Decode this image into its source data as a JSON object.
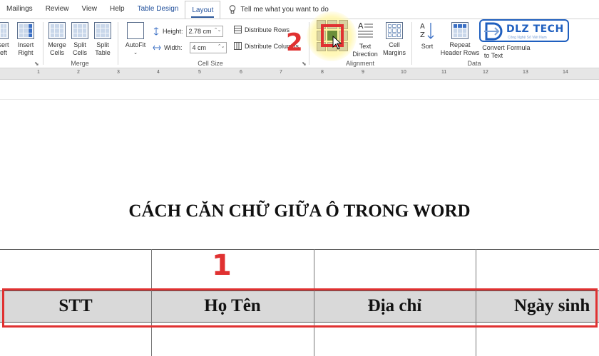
{
  "tabs": [
    "Mailings",
    "Review",
    "View",
    "Help",
    "Table Design",
    "Layout"
  ],
  "tell_me": "Tell me what you want to do",
  "ribbon": {
    "insert_left": "sert\neft",
    "insert_right": "Insert\nRight",
    "merge_cells": "Merge\nCells",
    "split_cells": "Split\nCells",
    "split_table": "Split\nTable",
    "merge_group": "Merge",
    "autofit": "AutoFit",
    "height_label": "Height:",
    "height_value": "2.78 cm",
    "width_label": "Width:",
    "width_value": "4 cm",
    "distribute_rows": "Distribute Rows",
    "distribute_columns": "Distribute Columns",
    "cell_size_group": "Cell Size",
    "text_direction": "Text\nDirection",
    "cell_margins": "Cell\nMargins",
    "alignment_group": "Alignment",
    "sort": "Sort",
    "repeat_header_rows": "Repeat\nHeader Rows",
    "convert_to_text": "Convert\nto Text",
    "formula": "Formula",
    "data_group": "Data"
  },
  "logo": {
    "text": "DLZ TECH",
    "sub": "Công Nghệ Số Việt Nam"
  },
  "ruler_numbers": [
    "1",
    "2",
    "3",
    "4",
    "5",
    "6",
    "7",
    "8",
    "9",
    "10",
    "11",
    "12",
    "13",
    "14"
  ],
  "document": {
    "title": "CÁCH CĂN CHỮ GIỮA Ô TRONG WORD",
    "header_cells": [
      "STT",
      "Họ Tên",
      "Địa chỉ",
      "Ngày sinh"
    ]
  },
  "annotations": {
    "step1": "1",
    "step2": "2"
  },
  "colors": {
    "accent": "#2b579a",
    "annotation": "#e03131",
    "logo": "#1f5fbf",
    "header_fill": "#d9d9d9"
  }
}
